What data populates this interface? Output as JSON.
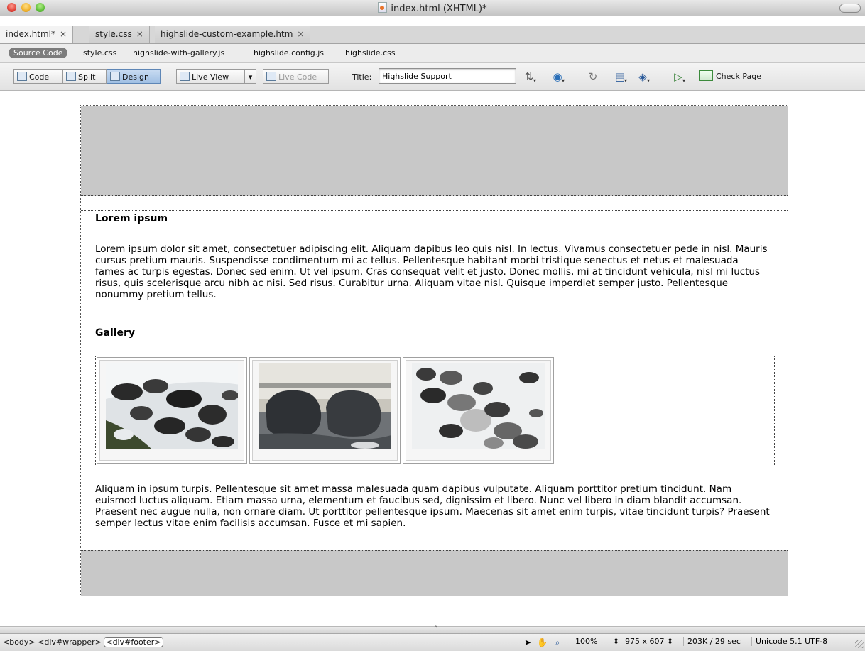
{
  "window": {
    "title": "index.html (XHTML)*"
  },
  "tabs": [
    {
      "label": "index.html*"
    },
    {
      "label": "style.css"
    },
    {
      "label": "highslide-custom-example.htm"
    }
  ],
  "tab_close_glyph": "×",
  "related_files": {
    "source_code": "Source Code",
    "files": [
      "style.css",
      "highslide-with-gallery.js",
      "highslide.config.js",
      "highslide.css"
    ]
  },
  "toolbar": {
    "code": "Code",
    "split": "Split",
    "design": "Design",
    "live_view": "Live View",
    "live_code": "Live Code",
    "title_label": "Title:",
    "title_value": "Highslide Support",
    "check_page": "Check Page",
    "icons": [
      "file-management-icon",
      "preview-browser-icon",
      "refresh-icon",
      "view-options-icon",
      "visual-aids-icon",
      "validate-icon"
    ]
  },
  "document": {
    "heading1": "Lorem ipsum",
    "paragraph1": "Lorem ipsum dolor sit amet, consectetuer adipiscing elit. Aliquam dapibus leo quis nisl. In lectus. Vivamus consectetuer pede in nisl. Mauris cursus pretium mauris. Suspendisse condimentum mi ac tellus. Pellentesque habitant morbi tristique senectus et netus et malesuada fames ac turpis egestas. Donec sed enim. Ut vel ipsum. Cras consequat velit et justo. Donec mollis, mi at tincidunt vehicula, nisl mi luctus risus, quis scelerisque arcu nibh ac nisi. Sed risus. Curabitur urna. Aliquam vitae nisl. Quisque imperdiet semper justo. Pellentesque nonummy pretium tellus.",
    "heading2": "Gallery",
    "gallery": [
      "snowy-rocks-photo",
      "boulders-at-sunset-photo",
      "rocky-shore-photo"
    ],
    "paragraph2": "Aliquam in ipsum turpis. Pellentesque sit amet massa malesuada quam dapibus vulputate. Aliquam porttitor pretium tincidunt. Nam euismod luctus aliquam. Etiam massa urna, elementum et faucibus sed, dignissim et libero. Nunc vel libero in diam blandit accumsan. Praesent nec augue nulla, non ornare diam. Ut porttitor pellentesque ipsum. Maecenas sit amet enim turpis, vitae tincidunt turpis? Praesent semper lectus vitae enim facilisis accumsan. Fusce et mi sapien."
  },
  "statusbar": {
    "tags": [
      "<body>",
      "<div#wrapper>",
      "<div#footer>"
    ],
    "zoom": "100%",
    "window_size": "975 x 607",
    "download": "203K / 29 sec",
    "encoding": "Unicode 5.1 UTF-8"
  },
  "colors": {
    "header_footer_gray": "#c8c8c8",
    "active_button_blue": "#9fbfe3"
  }
}
